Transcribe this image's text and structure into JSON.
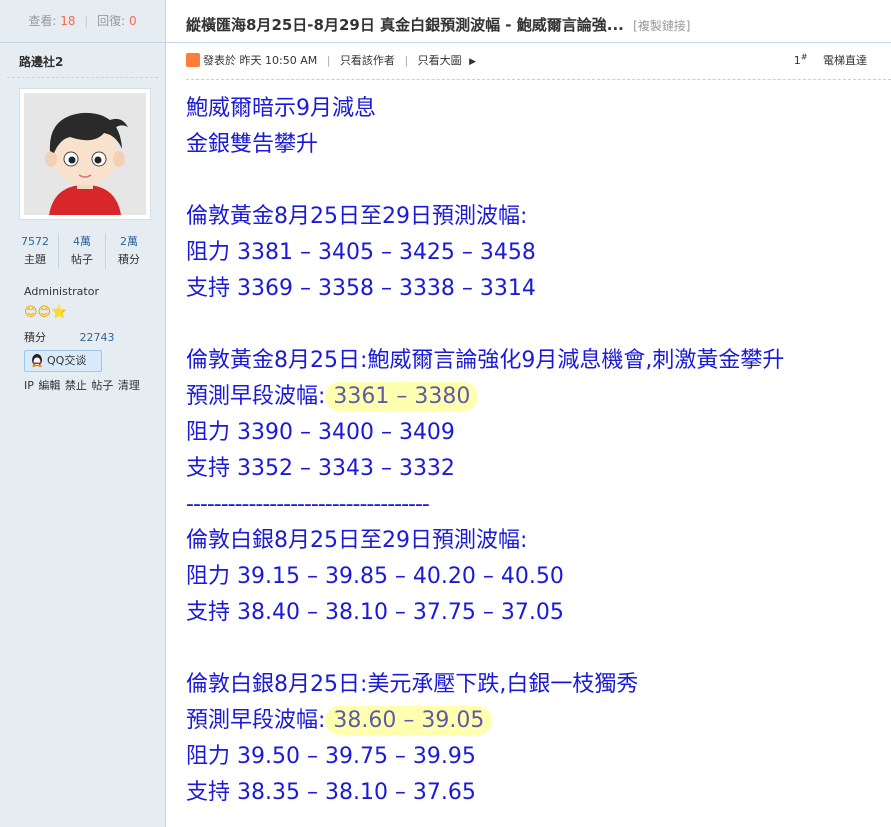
{
  "header": {
    "views_label": "查看:",
    "views_count": "18",
    "sep": "|",
    "replies_label": "回復:",
    "replies_count": "0",
    "title": "縱橫匯海8月25日-8月29日 真金白銀預測波幅 - 鮑威爾言論強...",
    "copy_link": "[複製鏈接]"
  },
  "sidebar": {
    "username": "路邊社2",
    "stats": [
      {
        "value": "7572",
        "label": "主題"
      },
      {
        "value": "4萬",
        "label": "帖子"
      },
      {
        "value": "2萬",
        "label": "積分"
      }
    ],
    "group": "Administrator",
    "stars": "😊😊⭐",
    "credits_label": "積分",
    "credits_value": "22743",
    "qq_label": "QQ交谈",
    "mod_links": "IP 編輯 禁止 帖子 清理"
  },
  "postmeta": {
    "posted": "發表於 昨天 10:50 AM",
    "only_author": "只看該作者",
    "large_image": "只看大圖",
    "arrow": "▶",
    "floor_num": "1",
    "floor_sup": "#",
    "jump": "電梯直達"
  },
  "post": {
    "l1": "鮑威爾暗示9月減息",
    "l2": "金銀雙告攀升",
    "l3": "倫敦黃金8月25日至29日預測波幅:",
    "l4": "阻力 3381 – 3405 – 3425 – 3458",
    "l5": "支持 3369 – 3358 – 3338 – 3314",
    "l6": "倫敦黃金8月25日:鮑威爾言論強化9月減息機會,刺激黃金攀升",
    "l7_label": "預測早段波幅:",
    "l7_value": "3361 – 3380",
    "l8": "阻力 3390 – 3400 – 3409",
    "l9": "支持 3352 – 3343 – 3332",
    "divider": "-----------------------------------",
    "l10": "倫敦白銀8月25日至29日預測波幅:",
    "l11": "阻力 39.15 – 39.85 – 40.20 – 40.50",
    "l12": "支持 38.40 – 38.10 – 37.75 – 37.05",
    "l13": "倫敦白銀8月25日:美元承壓下跌,白銀一枝獨秀",
    "l14_label": "預測早段波幅:",
    "l14_value": "38.60 – 39.05",
    "l15": "阻力 39.50 – 39.75 – 39.95",
    "l16": "支持 38.35 – 38.10 – 37.65"
  },
  "colors": {
    "accent_blue": "#1a1ad8",
    "sidebar_bg": "#e5edf2",
    "highlight": "#ffffb0"
  }
}
